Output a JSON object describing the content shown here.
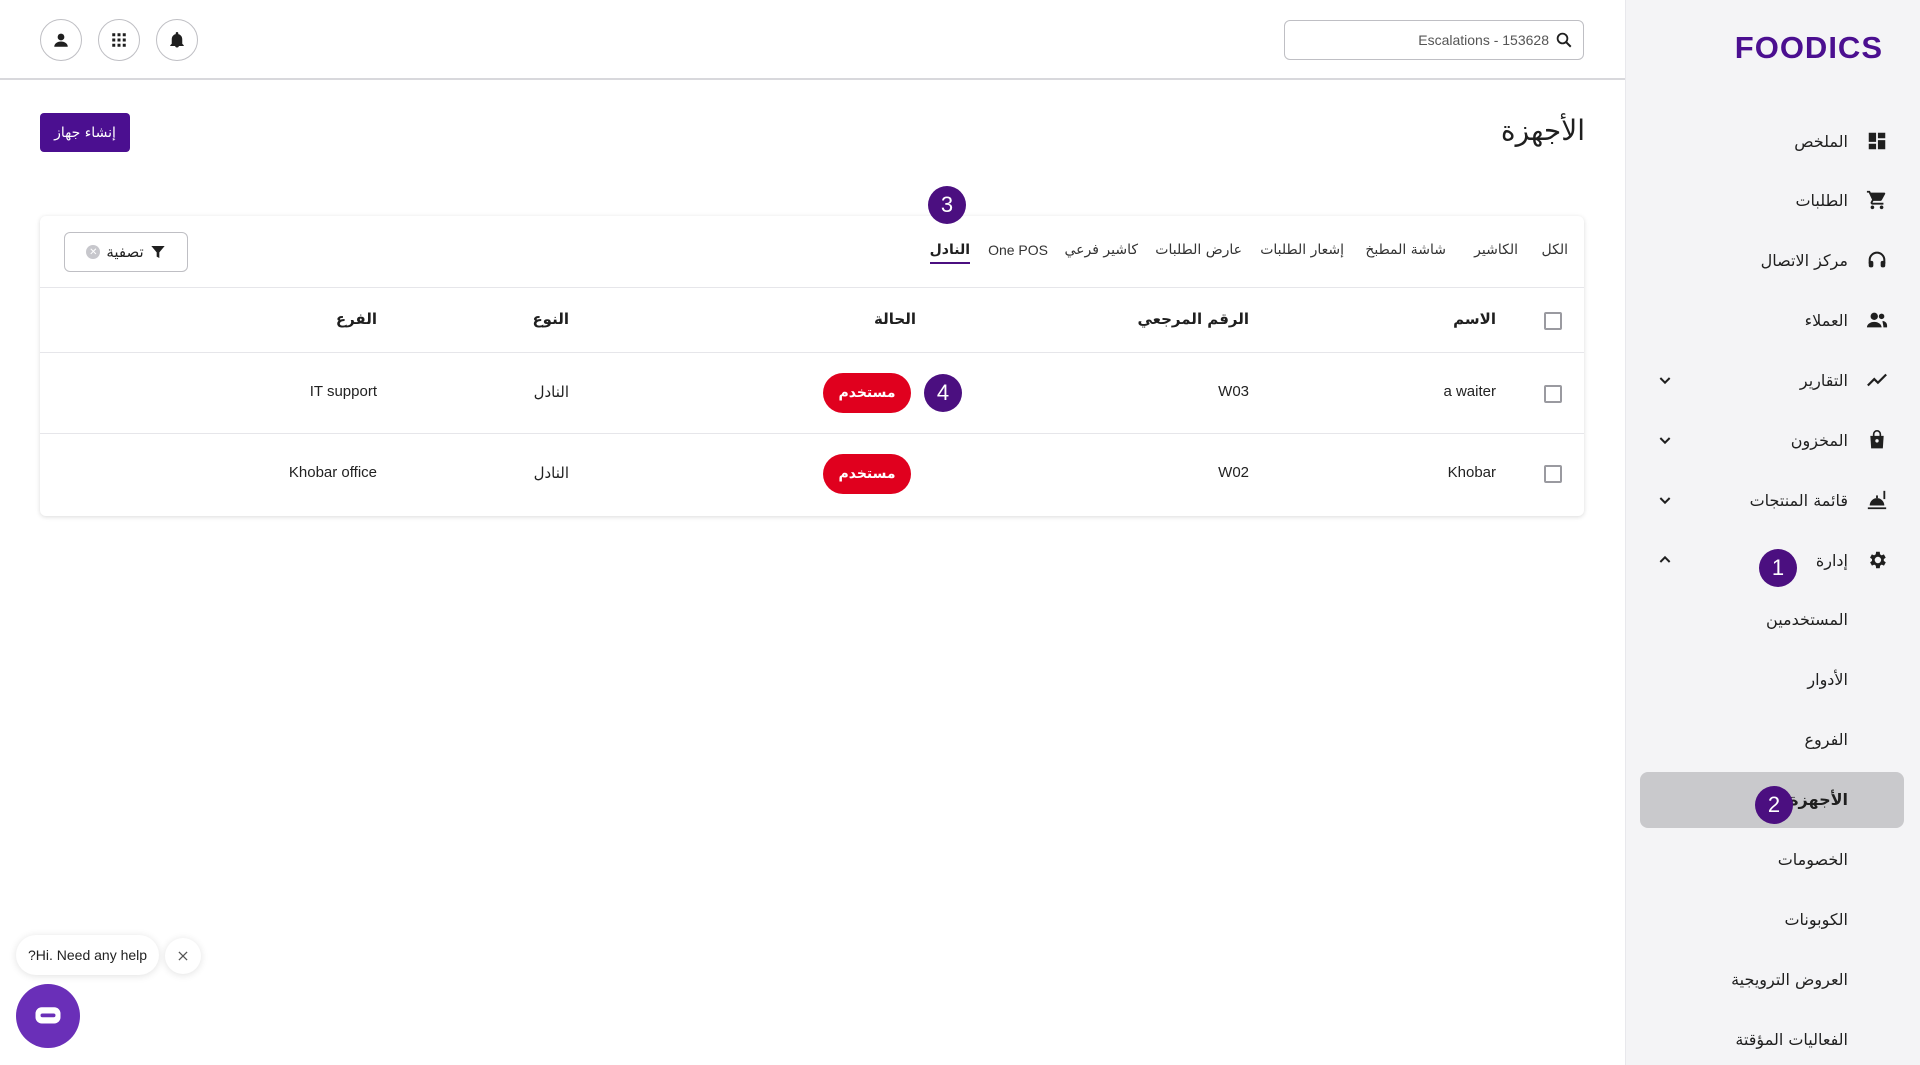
{
  "sidebar": {
    "brand": "FOODICS",
    "items": [
      {
        "label": "الملخص",
        "icon": "dashboard-icon"
      },
      {
        "label": "الطلبات",
        "icon": "cart-icon"
      },
      {
        "label": "مركز الاتصال",
        "icon": "headset-icon"
      },
      {
        "label": "العملاء",
        "icon": "customers-icon"
      },
      {
        "label": "التقارير",
        "icon": "trend-icon"
      },
      {
        "label": "المخزون",
        "icon": "bag-icon"
      },
      {
        "label": "قائمة المنتجات",
        "icon": "menu-food-icon"
      },
      {
        "label": "إدارة",
        "icon": "gear-icon"
      }
    ],
    "subitems": [
      {
        "label": "المستخدمين"
      },
      {
        "label": "الأدوار"
      },
      {
        "label": "الفروع"
      },
      {
        "label": "الأجهزة"
      },
      {
        "label": "الخصومات"
      },
      {
        "label": "الكوبونات"
      },
      {
        "label": "العروض الترويجية"
      },
      {
        "label": "الفعاليات المؤقتة"
      }
    ]
  },
  "header": {
    "search_value": "Escalations - 153628",
    "icons": [
      "user-icon",
      "apps-grid-icon",
      "bell-icon"
    ]
  },
  "page": {
    "title": "الأجهزة",
    "create_button": "إنشاء جهاز"
  },
  "tabs": [
    {
      "label": "الكل"
    },
    {
      "label": "الكاشير"
    },
    {
      "label": "شاشة المطبخ"
    },
    {
      "label": "إشعار الطلبات"
    },
    {
      "label": "عارض الطلبات"
    },
    {
      "label": "كاشير فرعي"
    },
    {
      "label": "One POS"
    },
    {
      "label": "النادل",
      "active": true
    }
  ],
  "filter": {
    "label": "تصفية"
  },
  "table": {
    "columns": {
      "name": "الاسم",
      "reference": "الرقم المرجعي",
      "status": "الحالة",
      "type": "النوع",
      "branch": "الفرع"
    },
    "rows": [
      {
        "name": "a waiter",
        "reference": "W03",
        "status": "مستخدم",
        "type": "النادل",
        "branch": "IT support"
      },
      {
        "name": "Khobar",
        "reference": "W02",
        "status": "مستخدم",
        "type": "النادل",
        "branch": "Khobar office"
      }
    ]
  },
  "annotations": [
    "1",
    "2",
    "3",
    "4"
  ],
  "chat": {
    "prompt": "?Hi. Need any help"
  },
  "colors": {
    "brand": "#4b0f90",
    "status_used": "#e0001e",
    "badge": "#4b0f80",
    "chat": "#6a2fb8"
  }
}
